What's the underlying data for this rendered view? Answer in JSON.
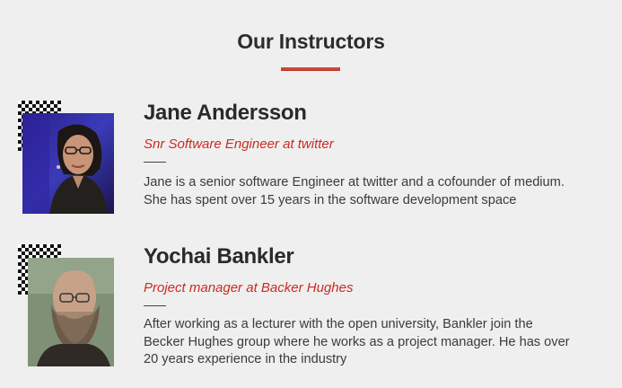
{
  "section": {
    "title": "Our Instructors"
  },
  "instructors": [
    {
      "name": "Jane Andersson",
      "role": "Snr Software Engineer at twitter",
      "bio_lines": [
        "Jane is a senior software Engineer at twitter and a cofounder of medium.",
        "She has spent over 15 years in the software development space"
      ]
    },
    {
      "name": "Yochai Bankler",
      "role": "Project manager at Backer Hughes",
      "bio_lines": [
        "After working as a lecturer with the open university, Bankler join the",
        "Becker Hughes group where he works as a project manager. He has over",
        "20 years experience in the industry"
      ]
    }
  ],
  "colors": {
    "accent": "#cc2a22",
    "background": "#efefef"
  }
}
